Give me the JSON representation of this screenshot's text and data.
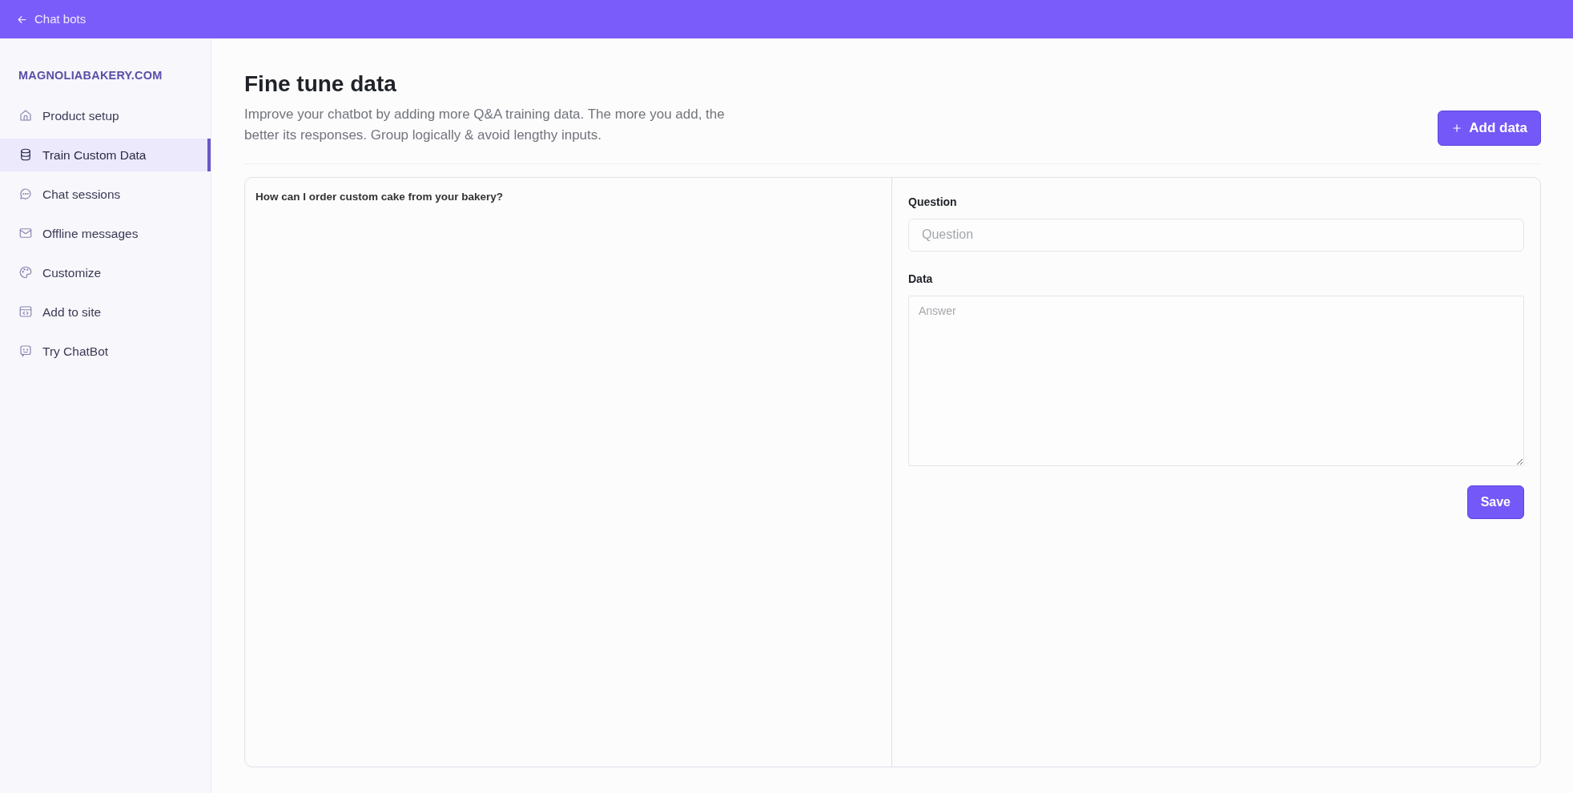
{
  "top_bar": {
    "back_label": "Chat bots"
  },
  "sidebar": {
    "site": "MAGNOLIABAKERY.COM",
    "items": [
      {
        "label": "Product setup",
        "kind": "home",
        "selected": false
      },
      {
        "label": "Train Custom Data",
        "kind": "database",
        "selected": true
      },
      {
        "label": "Chat sessions",
        "kind": "chat",
        "selected": false
      },
      {
        "label": "Offline messages",
        "kind": "mail",
        "selected": false
      },
      {
        "label": "Customize",
        "kind": "palette",
        "selected": false
      },
      {
        "label": "Add to site",
        "kind": "embed",
        "selected": false
      },
      {
        "label": "Try ChatBot",
        "kind": "bot",
        "selected": false
      }
    ]
  },
  "header": {
    "title": "Fine tune data",
    "description": "Improve your chatbot by adding more Q&A training data. The more you add, the better its responses. Group logically & avoid lengthy inputs.",
    "add_button": "Add data"
  },
  "entries": [
    {
      "question": "How can I order custom cake from your bakery?"
    }
  ],
  "form": {
    "question_label": "Question",
    "question_placeholder": "Question",
    "data_label": "Data",
    "data_placeholder": "Answer",
    "save_button": "Save"
  }
}
